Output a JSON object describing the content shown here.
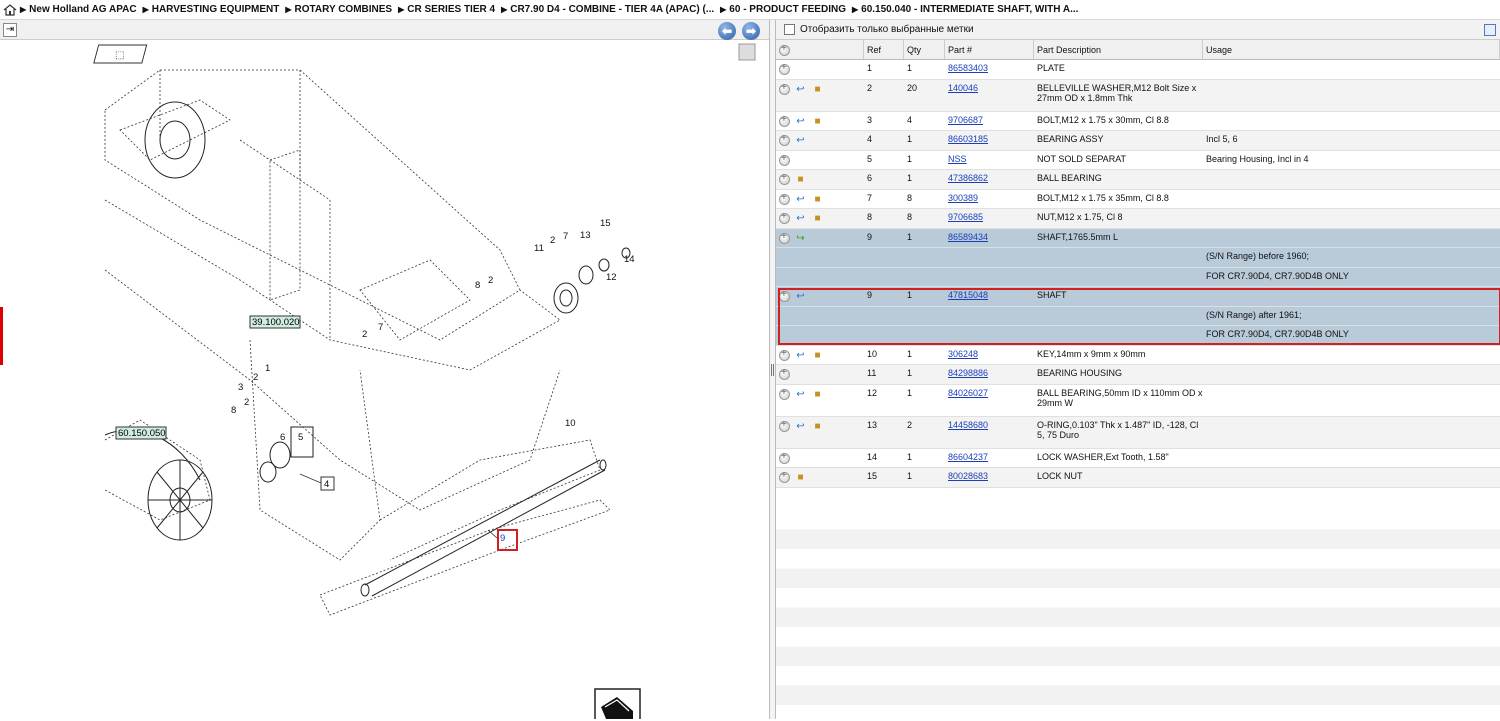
{
  "breadcrumb": [
    "New Holland AG APAC",
    "HARVESTING EQUIPMENT",
    "ROTARY COMBINES",
    "CR SERIES TIER 4",
    "CR7.90 D4 - COMBINE - TIER 4A (APAC) (...",
    "60 - PRODUCT FEEDING",
    "60.150.040 - INTERMEDIATE SHAFT, WITH A..."
  ],
  "filter": {
    "label": "Отобразить только выбранные метки"
  },
  "columns": [
    "Ref",
    "Qty",
    "Part #",
    "Part Description",
    "Usage"
  ],
  "parts": [
    {
      "ref": "1",
      "qty": "1",
      "part": "86583403",
      "desc": "PLATE",
      "usage": ""
    },
    {
      "ref": "2",
      "qty": "20",
      "part": "140046",
      "desc": "BELLEVILLE WASHER,M12 Bolt Size x 27mm OD x 1.8mm Thk",
      "usage": ""
    },
    {
      "ref": "3",
      "qty": "4",
      "part": "9706687",
      "desc": "BOLT,M12 x 1.75 x 30mm, Cl 8.8",
      "usage": ""
    },
    {
      "ref": "4",
      "qty": "1",
      "part": "86603185",
      "desc": "BEARING ASSY",
      "usage": "Incl 5, 6"
    },
    {
      "ref": "5",
      "qty": "1",
      "part": "NSS",
      "desc": "NOT SOLD SEPARAT",
      "usage": "Bearing Housing, Incl in 4"
    },
    {
      "ref": "6",
      "qty": "1",
      "part": "47386862",
      "desc": "BALL BEARING",
      "usage": ""
    },
    {
      "ref": "7",
      "qty": "8",
      "part": "300389",
      "desc": "BOLT,M12 x 1.75 x 35mm, Cl 8.8",
      "usage": ""
    },
    {
      "ref": "8",
      "qty": "8",
      "part": "9706685",
      "desc": "NUT,M12 x 1.75, Cl 8",
      "usage": ""
    },
    {
      "ref": "9",
      "qty": "1",
      "part": "86589434",
      "desc": "SHAFT,1765.5mm L",
      "usage": ""
    },
    {
      "ref": "",
      "qty": "",
      "part": "",
      "desc": "",
      "usage": "(S/N Range) before 1960;"
    },
    {
      "ref": "",
      "qty": "",
      "part": "",
      "desc": "",
      "usage": "FOR CR7.90D4, CR7.90D4B ONLY"
    },
    {
      "ref": "9",
      "qty": "1",
      "part": "47815048",
      "desc": "SHAFT",
      "usage": ""
    },
    {
      "ref": "",
      "qty": "",
      "part": "",
      "desc": "",
      "usage": "(S/N Range) after 1961;"
    },
    {
      "ref": "",
      "qty": "",
      "part": "",
      "desc": "",
      "usage": "FOR CR7.90D4, CR7.90D4B ONLY"
    },
    {
      "ref": "10",
      "qty": "1",
      "part": "306248",
      "desc": "KEY,14mm x 9mm x 90mm",
      "usage": ""
    },
    {
      "ref": "11",
      "qty": "1",
      "part": "84298886",
      "desc": "BEARING HOUSING",
      "usage": ""
    },
    {
      "ref": "12",
      "qty": "1",
      "part": "84026027",
      "desc": "BALL BEARING,50mm ID x 110mm OD x 29mm W",
      "usage": ""
    },
    {
      "ref": "13",
      "qty": "2",
      "part": "14458680",
      "desc": "O-RING,0.103\" Thk x 1.487\" ID, -128, Cl 5, 75 Duro",
      "usage": ""
    },
    {
      "ref": "14",
      "qty": "1",
      "part": "86604237",
      "desc": "LOCK WASHER,Ext Tooth, 1.58\"",
      "usage": ""
    },
    {
      "ref": "15",
      "qty": "1",
      "part": "80028683",
      "desc": "LOCK NUT",
      "usage": ""
    }
  ],
  "diagram": {
    "callouts": [
      "39.100.020",
      "60.150.050"
    ],
    "labels": [
      "1",
      "2",
      "3",
      "4",
      "5",
      "6",
      "7",
      "8",
      "9",
      "10",
      "11",
      "12",
      "13",
      "14",
      "15"
    ]
  }
}
